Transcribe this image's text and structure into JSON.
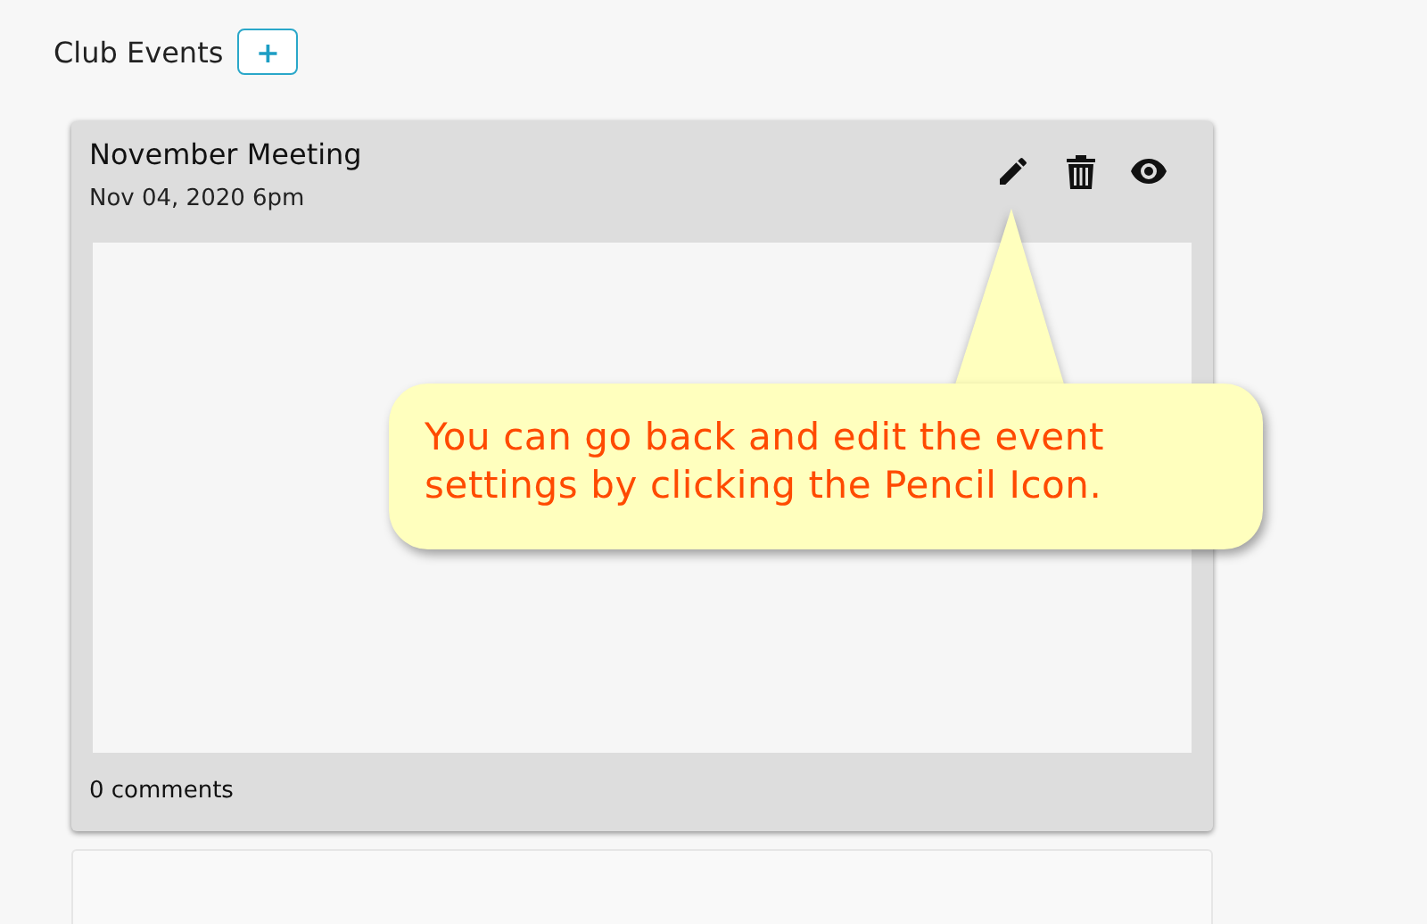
{
  "header": {
    "title": "Club Events",
    "add_button": "+"
  },
  "events": [
    {
      "title": "November Meeting",
      "date": "Nov 04, 2020 6pm",
      "comments": "0 comments"
    }
  ],
  "callout": {
    "text": "You can go back and edit the event settings by clicking the Pencil Icon."
  }
}
